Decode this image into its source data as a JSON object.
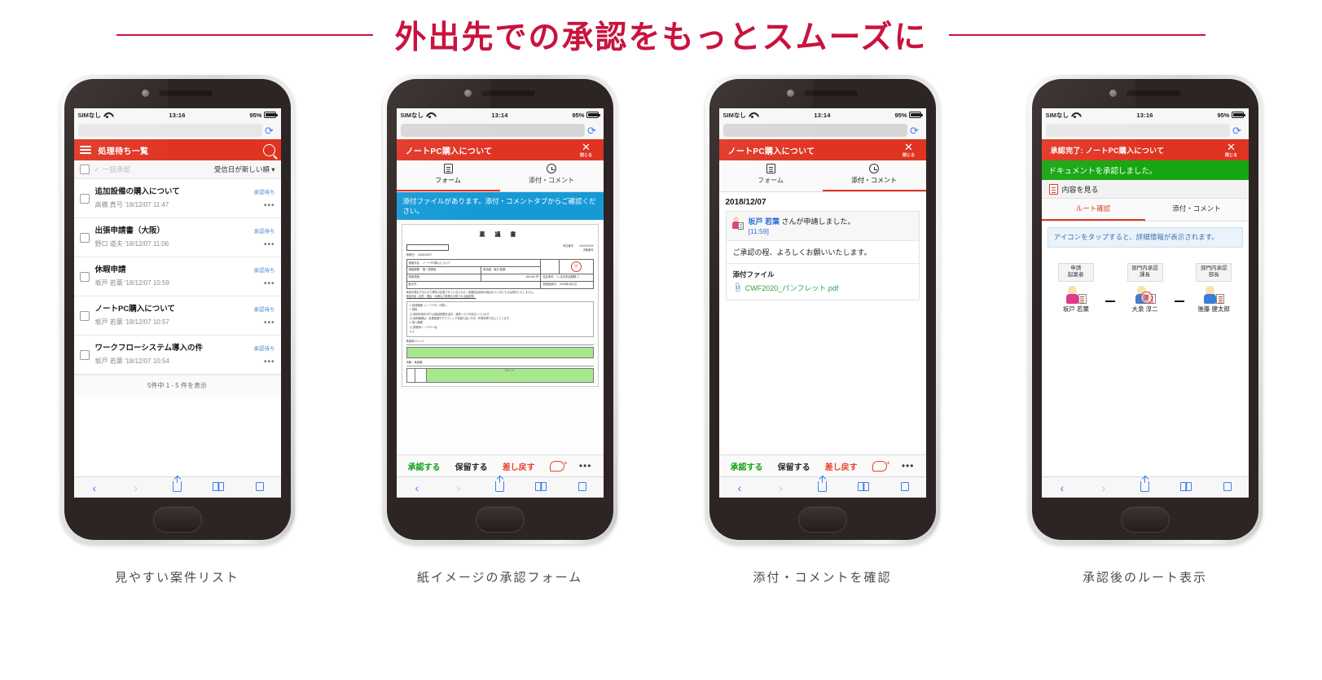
{
  "page": {
    "title": "外出先での承認をもっとスムーズに",
    "accent_color": "#c9133e",
    "app_red": "#e03423",
    "app_green": "#16a611"
  },
  "phones": [
    {
      "caption": "見やすい案件リスト",
      "status": {
        "carrier": "SIMなし",
        "time": "13:16",
        "battery": "95%"
      },
      "header": {
        "title": "処理待ち一覧"
      },
      "toolbar": {
        "bulk_label": "一括承認",
        "sort_label": "受信日が新しい順 ▾"
      },
      "items": [
        {
          "title": "追加設備の購入について",
          "sub": "高橋 真弓 '18/12/07 11:47",
          "status": "承認待ち"
        },
        {
          "title": "出張申請書（大阪）",
          "sub": "野口 道夫 '18/12/07 11:06",
          "status": "承認待ち"
        },
        {
          "title": "休暇申請",
          "sub": "坂戸 若葉 '18/12/07 10:59",
          "status": "承認待ち"
        },
        {
          "title": "ノートPC購入について",
          "sub": "坂戸 若葉 '18/12/07 10:57",
          "status": "承認待ち"
        },
        {
          "title": "ワークフローシステム導入の件",
          "sub": "坂戸 若葉 '18/12/07 10:54",
          "status": "承認待ち"
        }
      ],
      "footer": "5件中 1 - 5 件を表示"
    },
    {
      "caption": "紙イメージの承認フォーム",
      "status": {
        "carrier": "SIMなし",
        "time": "13:14",
        "battery": "95%"
      },
      "header": {
        "title": "ノートPC購入について",
        "close_label": "閉じる"
      },
      "tabs": [
        {
          "label": "フォーム",
          "active": true
        },
        {
          "label": "添付・コメント",
          "active": false
        }
      ],
      "notice": "添付ファイルがあります。添付・コメントタブからご確認ください。",
      "form": {
        "doc_title": "稟 議 書",
        "box_label": "（部門）",
        "date_label": "申請日： 2018/12/07",
        "meta_right_1": "申請番号　　 2018-K0004",
        "meta_right_2": "決裁番号",
        "rows": [
          {
            "label": "稟議件名：",
            "value": "ノートPC購入について"
          },
          {
            "label": "稟議部署： 第一営業部",
            "value": "申請者：坂戸 若葉"
          },
          {
            "label": "費用見積：",
            "value": "180,000 円",
            "label2": "支払条件",
            "value2": "当月末払期限"
          },
          {
            "label": "取引先 ：",
            "value": "",
            "label2": "初回起案日：",
            "value2": "2018年4月1日"
          }
        ],
        "note_1": "費用が発生するもので標準の記載されていないもの／金額協定契約が結ばれていないものは受付いたしません。",
        "note_2": "稟議内容（目的・理由・効果など概算を計算される経緯等）",
        "bullets": [
          "1. 経営機器（ノートPC）の購入",
          "2. 理由",
          "(1) 現状利用中のPCは保証期間を過ぎ、故障リスクが高まっています",
          "(2) 最新機種は、処理速度やグラフィック性能も高いため、作業効率も向上しています",
          "3. 購入機種",
          "(1) 業務用ノートPC 1台",
          "以上"
        ],
        "comment_label": "承認時コメント",
        "approver_label": "決裁・承認欄",
        "comment_col": "コメント"
      },
      "actions": {
        "approve": "承認する",
        "hold": "保留する",
        "reject": "差し戻す"
      }
    },
    {
      "caption": "添付・コメントを確認",
      "status": {
        "carrier": "SIMなし",
        "time": "13:14",
        "battery": "95%"
      },
      "header": {
        "title": "ノートPC購入について",
        "close_label": "閉じる"
      },
      "tabs": [
        {
          "label": "フォーム",
          "active": false
        },
        {
          "label": "添付・コメント",
          "active": true
        }
      ],
      "comments": {
        "date": "2018/12/07",
        "author": "坂戸 若葉",
        "action_text": " さんが申請しました。",
        "time": "[11:59]",
        "body": "ご承認の程、よろしくお願いいたします。",
        "attach_title": "添付ファイル",
        "attach_file": "CWF2020_パンフレット.pdf"
      },
      "actions": {
        "approve": "承認する",
        "hold": "保留する",
        "reject": "差し戻す"
      }
    },
    {
      "caption": "承認後のルート表示",
      "status": {
        "carrier": "SIMなし",
        "time": "13:16",
        "battery": "95%"
      },
      "header": {
        "title": "承認完了: ノートPC購入について",
        "close_label": "閉じる"
      },
      "success": "ドキュメントを承認しました。",
      "view_content": "内容を見る",
      "tabs": [
        {
          "label": "ルート確認",
          "active": true
        },
        {
          "label": "添付・コメント",
          "active": false
        }
      ],
      "notice": "アイコンをタップすると、詳細情報が表示されます。",
      "route": [
        {
          "role": "申請\n起案者",
          "name": "坂戸 若葉",
          "stamped": false,
          "color": "pink"
        },
        {
          "role": "部門内承認\n課長",
          "name": "大泉 淳二",
          "stamped": true,
          "stamp": "済",
          "color": "blue"
        },
        {
          "role": "部門内承認\n部長",
          "name": "後藤 健太郎",
          "stamped": false,
          "color": "blue"
        }
      ]
    }
  ]
}
